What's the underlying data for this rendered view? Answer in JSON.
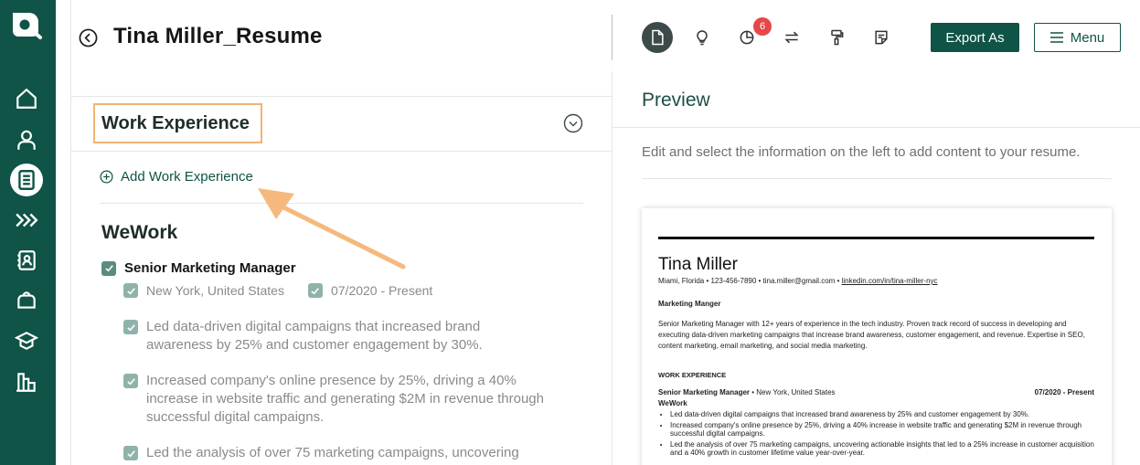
{
  "header": {
    "title": "Tina Miller_Resume",
    "notification_count": "6",
    "export_label": "Export As",
    "menu_label": "Menu"
  },
  "editor": {
    "section_title": "Work Experience",
    "add_label": "Add Work Experience",
    "company": "WeWork",
    "job_title": "Senior Marketing Manager",
    "location": "New York, United States",
    "dates": "07/2020 - Present",
    "bullets": [
      "Led data-driven digital campaigns that increased brand awareness by 25% and customer engagement by 30%.",
      "Increased company's online presence by 25%, driving a 40% increase in website traffic and generating $2M in revenue through successful digital campaigns.",
      "Led the analysis of over 75 marketing campaigns, uncovering"
    ]
  },
  "preview": {
    "title": "Preview",
    "hint": "Edit and select the information on the left to add content to your resume.",
    "resume": {
      "name": "Tina Miller",
      "contact": "Miami, Florida • 123-456-7890 • tina.miller@gmail.com • ",
      "linkedin": "linkedin.com/in/tina-miller-nyc",
      "headline": "Marketing Manger",
      "summary": "Senior Marketing Manager with 12+ years of experience in the tech industry. Proven track record of success in developing and executing data-driven marketing campaigns that increase brand awareness, customer engagement, and revenue. Expertise in SEO, content marketing, email marketing, and social media marketing.",
      "section": "WORK EXPERIENCE",
      "job_title": "Senior Marketing Manager",
      "job_location": " • New York, United States",
      "dates": "07/2020 - Present",
      "company": "WeWork",
      "bullets": [
        "Led data-driven digital campaigns that increased brand awareness by 25% and customer engagement by 30%.",
        "Increased company's online presence by 25%, driving a 40% increase in website traffic and generating $2M in revenue through successful digital campaigns.",
        "Led the analysis of over 75 marketing campaigns, uncovering actionable insights that led to a 25% increase in customer acquisition and a 40% growth in customer lifetime value year-over-year."
      ]
    }
  },
  "colors": {
    "brand": "#0f5446",
    "highlight": "#f2b373",
    "arrow": "#f5b97d",
    "badge": "#e44848"
  },
  "icons": {
    "logo": "brand-logo",
    "nav": [
      "home-icon",
      "profile-icon",
      "resume-icon",
      "chevrons-icon",
      "contacts-icon",
      "briefcase-icon",
      "education-icon",
      "analytics-icon"
    ],
    "toolbar": [
      "document-icon",
      "lightbulb-icon",
      "pie-chart-icon",
      "swap-icon",
      "paint-roller-icon",
      "note-icon"
    ]
  }
}
